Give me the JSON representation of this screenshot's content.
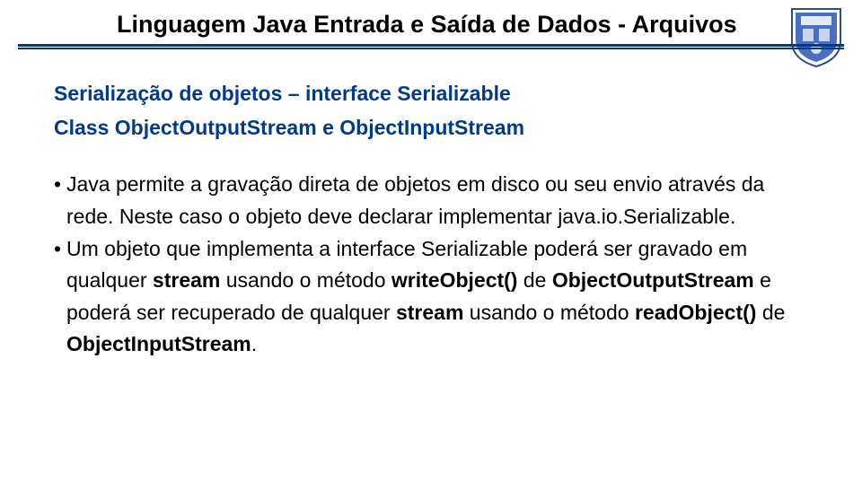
{
  "header": {
    "title": "Linguagem Java Entrada e Saída de Dados - Arquivos"
  },
  "subtitle": {
    "line1": "Serialização de objetos – interface Serializable",
    "line2_prefix": "Class ",
    "line2_a": "ObjectOutputStream",
    "line2_mid": " e ",
    "line2_b": "ObjectInputStream"
  },
  "bullets": {
    "b1_pre": "Java permite a gravação direta de objetos em disco ou seu envio através da rede. Neste caso o objeto deve declarar implementar ",
    "b1_code": "java.io.Serializable.",
    "b2_pre": "Um objeto que implementa a interface Serializable poderá ser gravado em qualquer ",
    "b2_s1": "stream",
    "b2_mid1": " usando o método ",
    "b2_m1": "writeObject()",
    "b2_mid2": " de ",
    "b2_c1": "ObjectOutputStream",
    "b2_mid3": " e poderá ser recuperado de qualquer ",
    "b2_s2": "stream",
    "b2_mid4": " usando o método ",
    "b2_m2": "readObject()",
    "b2_mid5": " de ",
    "b2_c2": "ObjectInputStream",
    "b2_end": "."
  }
}
